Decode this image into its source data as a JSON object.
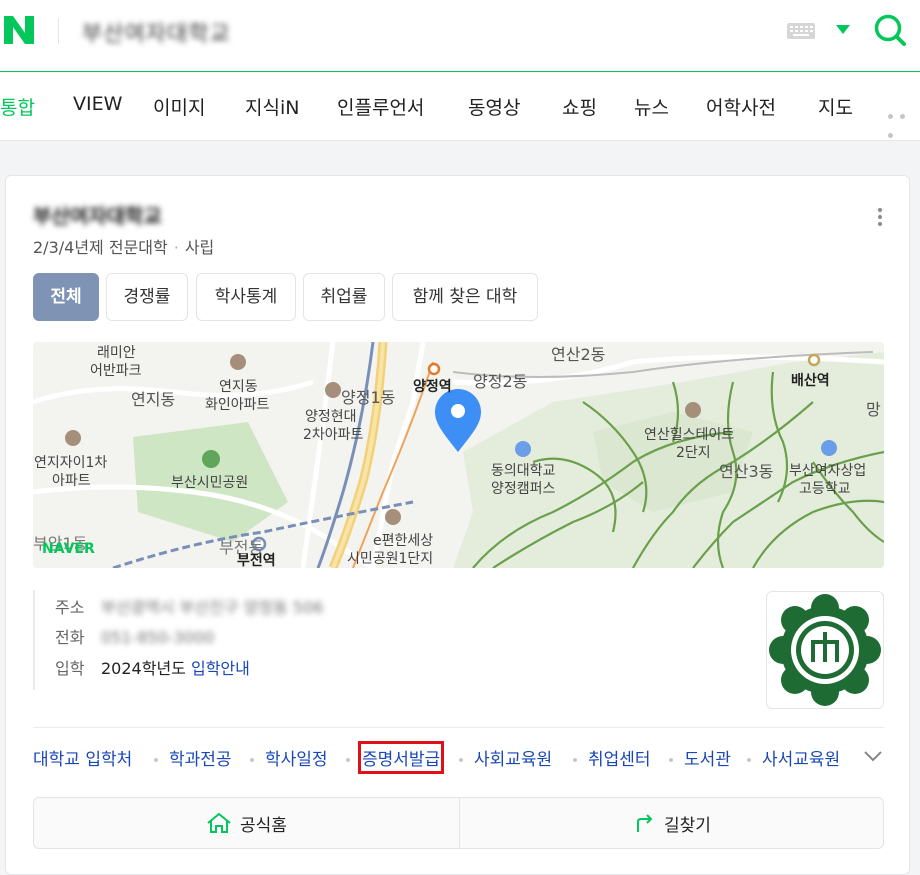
{
  "header": {
    "query": "부산여자대학교",
    "brand_color": "#03c75a"
  },
  "tabs": [
    {
      "label": "통합",
      "active": true
    },
    {
      "label": "VIEW"
    },
    {
      "label": "이미지"
    },
    {
      "label": "지식iN"
    },
    {
      "label": "인플루언서"
    },
    {
      "label": "동영상"
    },
    {
      "label": "쇼핑"
    },
    {
      "label": "뉴스"
    },
    {
      "label": "어학사전"
    },
    {
      "label": "지도"
    }
  ],
  "card": {
    "name": "부산여자대학교",
    "type": "2/3/4년제 전문대학",
    "ownership": "사립",
    "chips": [
      {
        "label": "전체",
        "active": true
      },
      {
        "label": "경쟁률"
      },
      {
        "label": "학사통계"
      },
      {
        "label": "취업률"
      },
      {
        "label": "함께 찾은 대학"
      }
    ],
    "map": {
      "logo": "NAVER",
      "labels": {
        "l1": "래미안",
        "l2": "어반파크",
        "l3": "연지동",
        "l4": "연지동",
        "l5": "화인아파트",
        "l6": "양정1동",
        "l7": "양정역",
        "l8": "양정2동",
        "l9": "연산2동",
        "l10": "배산역",
        "l11": "망",
        "l12": "양정현대",
        "l13": "2차아파트",
        "l14": "연산힐스테이트",
        "l15": "2단지",
        "l16": "연지자이1차",
        "l17": "아파트",
        "l18": "부산시민공원",
        "l19": "동의대학교",
        "l20": "양정캠퍼스",
        "l21": "연산3동",
        "l22": "부산여자상업",
        "l23": "고등학교",
        "l24": "부암1동",
        "l25": "부전동",
        "l26": "부전역",
        "l27": "e편한세상",
        "l28": "시민공원1단지"
      }
    },
    "info": {
      "address_label": "주소",
      "address_value": "부산광역시 부산진구 양정동 506",
      "phone_label": "전화",
      "phone_value": "051-850-3000",
      "admission_label": "입학",
      "admission_text": "2024학년도",
      "admission_link": "입학안내"
    },
    "quicklinks": [
      "대학교 입학처",
      "학과전공",
      "학사일정",
      "증명서발급",
      "사회교육원",
      "취업센터",
      "도서관",
      "사서교육원"
    ],
    "buttons": {
      "home": "공식홈",
      "directions": "길찾기"
    }
  }
}
